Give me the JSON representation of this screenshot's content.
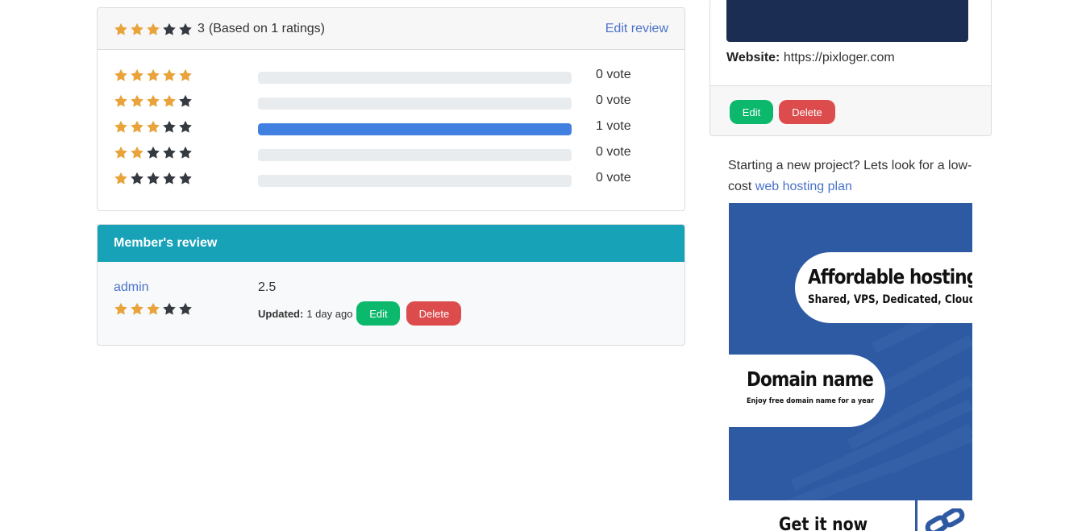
{
  "ratings": {
    "average": "3",
    "based_on": "(Based on 1 ratings)",
    "average_stars": 3,
    "edit_review_label": "Edit review",
    "distribution": [
      {
        "stars": 5,
        "votes": "0 vote",
        "fraction": 0
      },
      {
        "stars": 4,
        "votes": "0 vote",
        "fraction": 0
      },
      {
        "stars": 3,
        "votes": "1 vote",
        "fraction": 1
      },
      {
        "stars": 2,
        "votes": "0 vote",
        "fraction": 0
      },
      {
        "stars": 1,
        "votes": "0 vote",
        "fraction": 0
      }
    ]
  },
  "member_review": {
    "title": "Member's review",
    "user": "admin",
    "stars": 3,
    "score": "2.5",
    "updated_label": "Updated:",
    "updated_value": "1 day ago",
    "edit_label": "Edit",
    "delete_label": "Delete"
  },
  "sidebar": {
    "website_label": "Website:",
    "website_value": "https://pixloger.com",
    "edit_label": "Edit",
    "delete_label": "Delete",
    "promo_text": "Starting a new project? Lets look for a low-cost ",
    "promo_link": "web hosting plan"
  },
  "ad": {
    "headline1": "Affordable hosting",
    "sub1": "Shared, VPS, Dedicated, Cloud",
    "headline2": "Domain name",
    "sub2": "Enjoy free domain name for a year",
    "cta": "Get it now"
  },
  "colors": {
    "star_on": "#e9a33b",
    "star_off": "#343a40",
    "bar_fill": "#4180e0",
    "member_header": "#17a2b8",
    "edit_button": "#0bb86c",
    "delete_button": "#dc4c4c",
    "ad_background": "#2d5aa3"
  }
}
